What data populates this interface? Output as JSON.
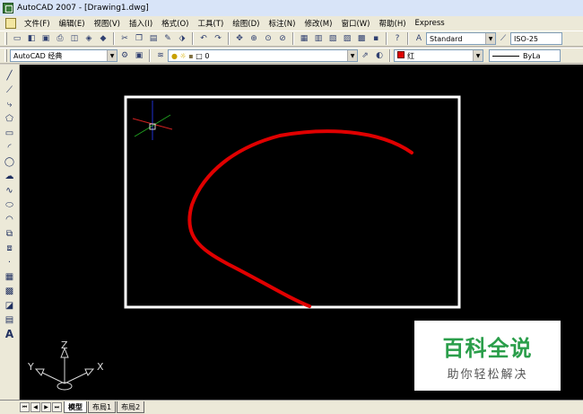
{
  "window": {
    "title": "AutoCAD 2007 - [Drawing1.dwg]"
  },
  "menubar": {
    "items": [
      "文件(F)",
      "编辑(E)",
      "视图(V)",
      "插入(I)",
      "格式(O)",
      "工具(T)",
      "绘图(D)",
      "标注(N)",
      "修改(M)",
      "窗口(W)",
      "帮助(H)",
      "Express"
    ]
  },
  "toolbar_standard": {
    "text_style": "Standard",
    "dim_style": "ISO-25"
  },
  "toolbar_layers": {
    "workspace": "AutoCAD 经典",
    "layer": "0",
    "color": "红",
    "linetype": "ByLa"
  },
  "canvas": {
    "axis_labels": {
      "z": "Z",
      "y": "Y",
      "x": "X"
    },
    "colors": {
      "arc": "#e00000",
      "viewport": "#ffffff",
      "background": "#000000"
    }
  },
  "watermark": {
    "title": "百科全说",
    "subtitle": "助你轻松解决"
  },
  "tabs": [
    "模型",
    "布局1",
    "布局2"
  ]
}
